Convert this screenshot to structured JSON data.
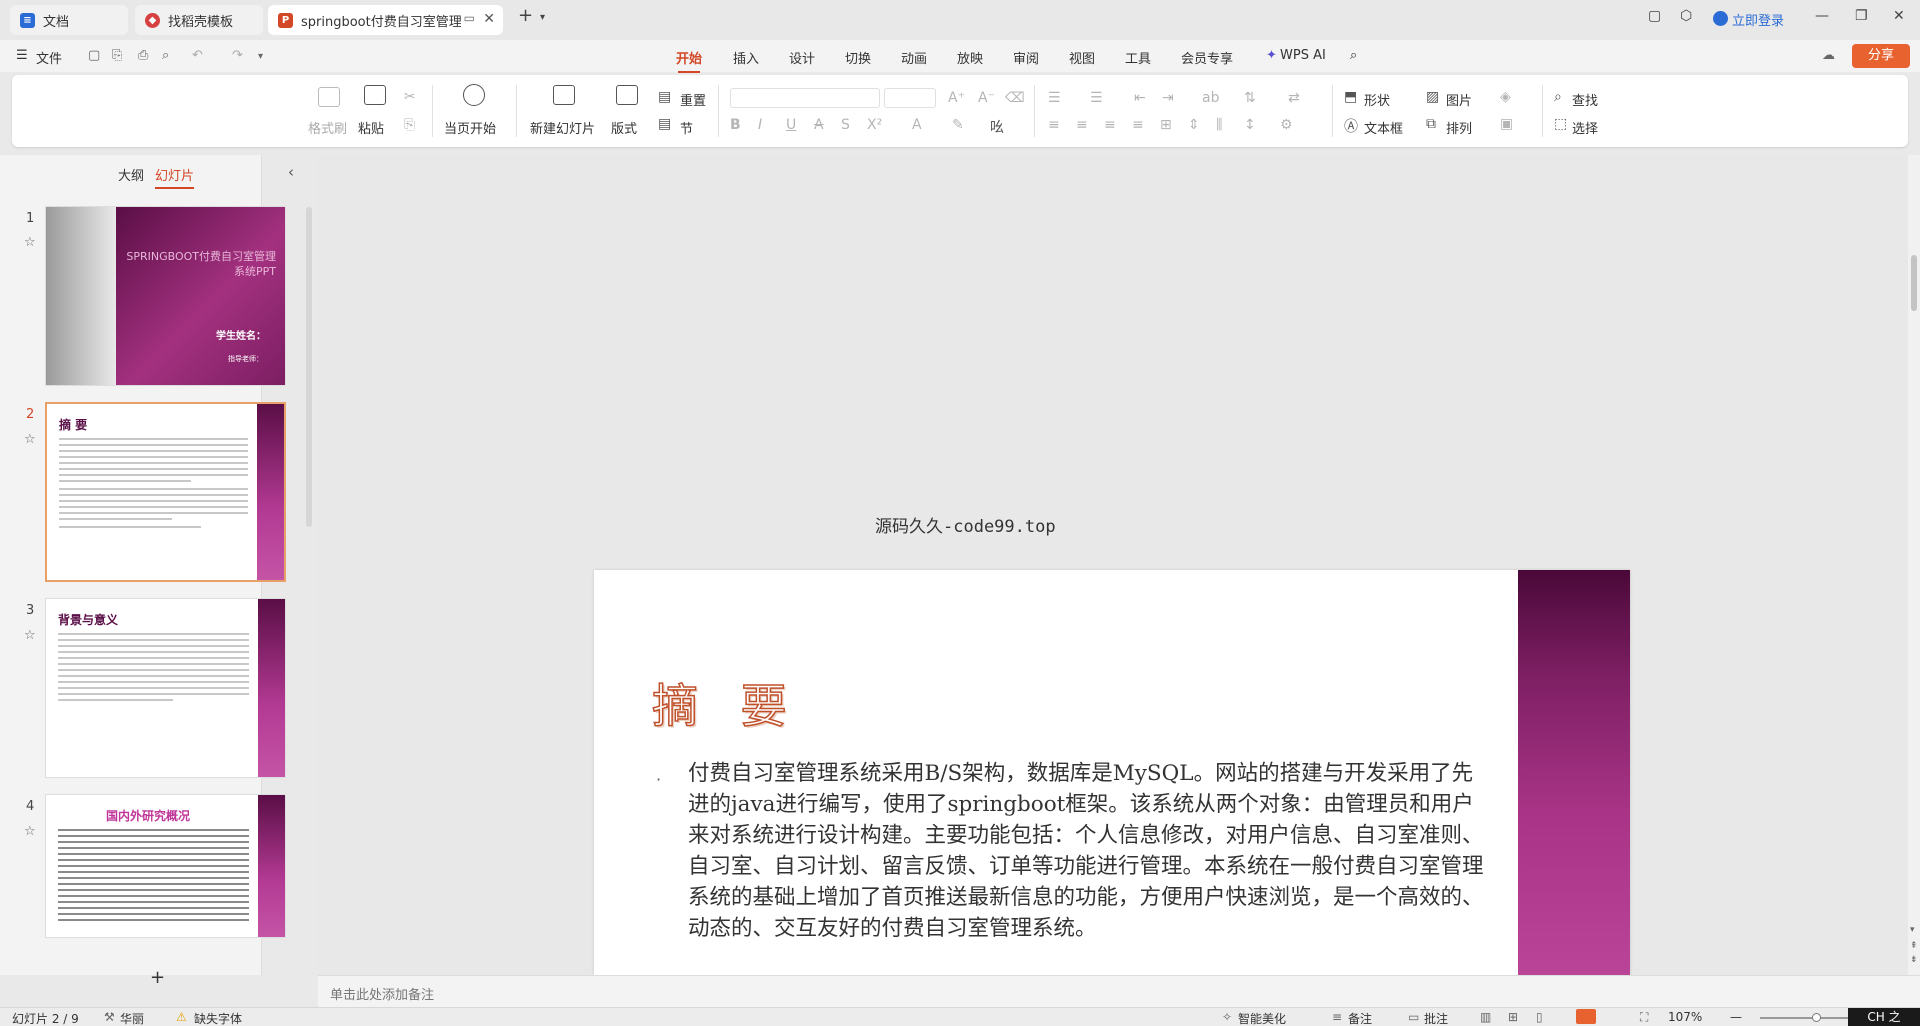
{
  "titlebar": {
    "tabs": [
      {
        "label": "文档",
        "icon": "doc-icon"
      },
      {
        "label": "找稻壳模板",
        "icon": "template-icon"
      },
      {
        "label": "springboot付费自习室管理",
        "icon": "ppt-icon"
      }
    ],
    "login_label": "立即登录"
  },
  "menubar": {
    "file_label": "文件",
    "items": [
      "开始",
      "插入",
      "设计",
      "切换",
      "动画",
      "放映",
      "审阅",
      "视图",
      "工具",
      "会员专享"
    ],
    "active": "开始",
    "wps_ai_label": "WPS AI",
    "share_label": "分享"
  },
  "ribbon": {
    "format_painter": "格式刷",
    "paste": "粘贴",
    "start_from_current": "当页开始",
    "new_slide": "新建幻灯片",
    "layout": "版式",
    "reset": "重置",
    "section": "节",
    "shape": "形状",
    "picture": "图片",
    "textbox": "文本框",
    "arrange": "排列",
    "find": "查找",
    "select": "选择"
  },
  "leftpanel": {
    "tab_outline": "大纲",
    "tab_slides": "幻灯片",
    "slides": [
      {
        "num": "1",
        "title": "SPRINGBOOT付费自习室管理系统PPT",
        "sub1": "学生姓名：",
        "sub2": "指导老师："
      },
      {
        "num": "2",
        "title": "摘  要"
      },
      {
        "num": "3",
        "title": "背景与意义"
      },
      {
        "num": "4",
        "title": "国内外研究概况"
      }
    ],
    "add_label": "+"
  },
  "canvas": {
    "watermark": "源码久久-code99.top",
    "slide_title": "摘 要",
    "bullet": "·",
    "slide_body": "付费自习室管理系统采用B/S架构，数据库是MySQL。网站的搭建与开发采用了先进的java进行编写，使用了springboot框架。该系统从两个对象：由管理员和用户来对系统进行设计构建。主要功能包括：个人信息修改，对用户信息、自习室准则、自习室、自习计划、留言反馈、订单等功能进行管理。本系统在一般付费自习室管理系统的基础上增加了首页推送最新信息的功能，方便用户快速浏览，是一个高效的、动态的、交互友好的付费自习室管理系统。"
  },
  "notes": {
    "placeholder": "单击此处添加备注"
  },
  "statusbar": {
    "slide_indicator": "幻灯片 2 / 9",
    "theme": "华丽",
    "missing_font": "缺失字体",
    "smart_beautify": "智能美化",
    "notes": "备注",
    "comments": "批注",
    "zoom": "107%",
    "ime": "CH 之"
  },
  "colors": {
    "accent": "#d24726",
    "slide_bar": "#9a2b7c"
  }
}
